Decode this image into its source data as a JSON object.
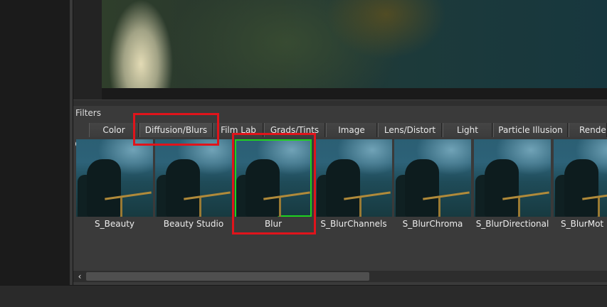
{
  "filters": {
    "title": "Filters",
    "tabs": [
      {
        "label": "Color"
      },
      {
        "label": "Diffusion/Blurs"
      },
      {
        "label": "Film Lab"
      },
      {
        "label": "Grads/Tints"
      },
      {
        "label": "Image"
      },
      {
        "label": "Lens/Distort"
      },
      {
        "label": "Light"
      },
      {
        "label": "Particle Illusion"
      },
      {
        "label": "Render"
      }
    ],
    "thumbnails": [
      {
        "label": "S_Beauty"
      },
      {
        "label": "Beauty Studio"
      },
      {
        "label": "Blur"
      },
      {
        "label": "S_BlurChannels"
      },
      {
        "label": "S_BlurChroma"
      },
      {
        "label": "S_BlurDirectional"
      },
      {
        "label": "S_BlurMot"
      }
    ],
    "active_tab": "Diffusion/Blurs",
    "selected_thumbnail": "Blur"
  },
  "colors": {
    "highlight_box": "#e0141b",
    "selection_outline": "#1fd21f",
    "panel_background": "#3a3a3a"
  },
  "icons": {
    "search": "search-icon",
    "scroll_left": "chevron-left-icon"
  },
  "scrollbar": {
    "left_arrow": "‹"
  }
}
